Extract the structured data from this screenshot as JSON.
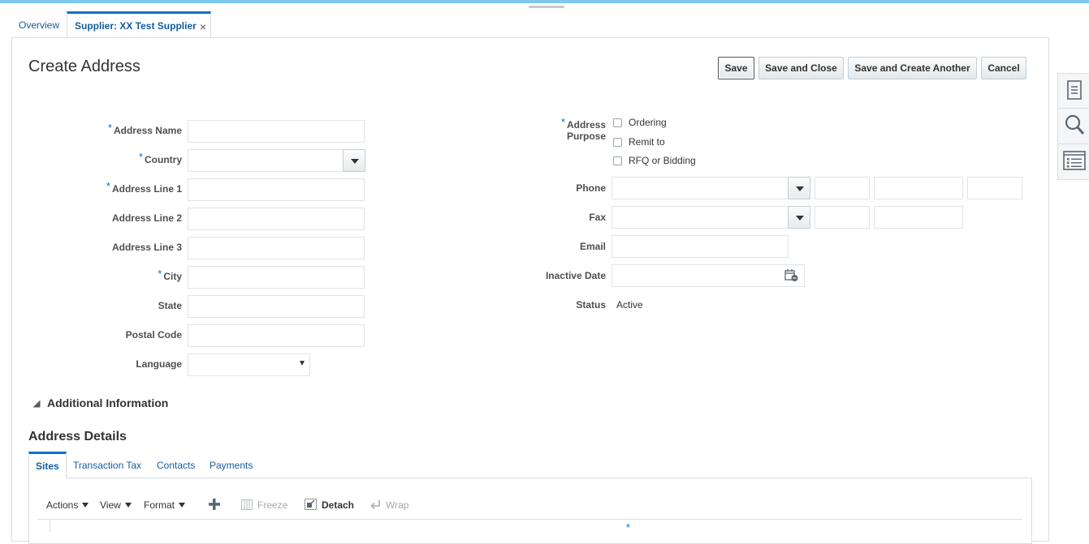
{
  "tabs": {
    "overview": "Overview",
    "supplier": "Supplier: XX Test Supplier",
    "close_glyph": "×"
  },
  "page": {
    "title": "Create Address"
  },
  "buttons": {
    "save": "Save",
    "save_close": "Save and Close",
    "save_create": "Save and Create Another",
    "cancel": "Cancel"
  },
  "required_mark": "*",
  "form": {
    "address_name": "Address Name",
    "country": "Country",
    "address_line_1": "Address Line 1",
    "address_line_2": "Address Line 2",
    "address_line_3": "Address Line 3",
    "city": "City",
    "state": "State",
    "postal_code": "Postal Code",
    "language": "Language",
    "address_purpose_1": "Address",
    "address_purpose_2": "Purpose",
    "purpose_ordering": "Ordering",
    "purpose_remit": "Remit to",
    "purpose_rfq": "RFQ or Bidding",
    "phone": "Phone",
    "fax": "Fax",
    "email": "Email",
    "inactive_date": "Inactive Date",
    "status": "Status",
    "status_value": "Active"
  },
  "sections": {
    "additional_info": "Additional Information",
    "address_details": "Address Details"
  },
  "subtabs": {
    "sites": "Sites",
    "transaction_tax": "Transaction Tax",
    "contacts": "Contacts",
    "payments": "Payments"
  },
  "toolbar": {
    "actions": "Actions",
    "view": "View",
    "format": "Format",
    "freeze": "Freeze",
    "detach": "Detach",
    "wrap": "Wrap"
  },
  "icons": {
    "add": "plus-icon",
    "freeze": "freeze-columns-icon",
    "detach": "detach-icon",
    "wrap": "wrap-icon",
    "calendar": "calendar-icon",
    "side_1": "document-icon",
    "side_2": "search-icon",
    "side_3": "list-icon"
  },
  "colors": {
    "accent": "#0572ce",
    "link": "#145c9e",
    "top_bar": "#7ec8ef"
  }
}
